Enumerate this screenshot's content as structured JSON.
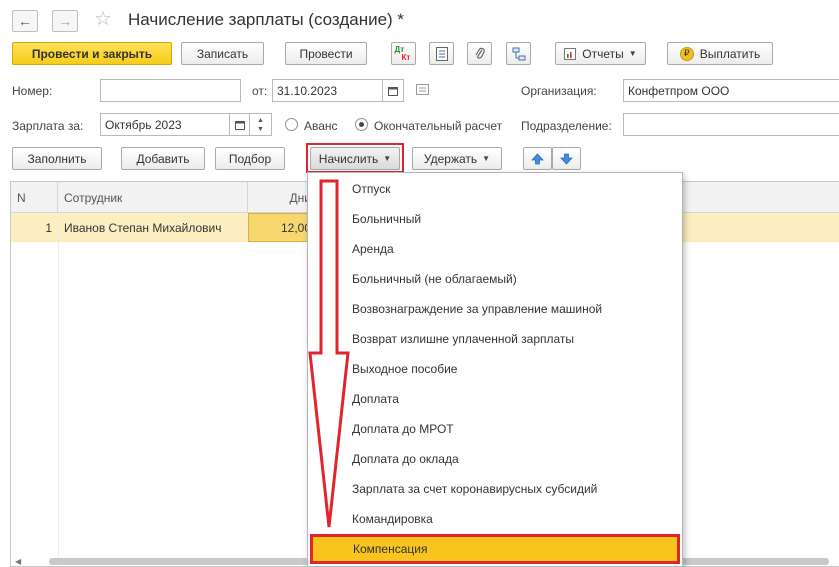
{
  "window": {
    "back_icon": "arrow-left-icon",
    "forward_icon": "arrow-right-icon",
    "favorite_icon": "star-icon",
    "title": "Начисление зарплаты (создание) *"
  },
  "toolbar": {
    "post_close": "Провести и закрыть",
    "save": "Записать",
    "post": "Провести",
    "dt_label": "Дт",
    "kt_label": "Кт",
    "reports": "Отчеты",
    "pay": "Выплатить",
    "pay_coin": "₽"
  },
  "form": {
    "number_label": "Номер:",
    "number_value": "",
    "date_label": "от:",
    "date_value": "31.10.2023",
    "org_label": "Организация:",
    "org_value": "Конфетпром ООО",
    "salary_label": "Зарплата за:",
    "salary_value": "Октябрь 2023",
    "advance_label": "Аванс",
    "final_label": "Окончательный расчет",
    "calc_mode": "final",
    "division_label": "Подразделение:",
    "division_value": ""
  },
  "table_toolbar": {
    "fill": "Заполнить",
    "add": "Добавить",
    "select": "Подбор",
    "accrue": "Начислить",
    "withhold": "Удержать"
  },
  "table": {
    "columns": [
      "N",
      "Сотрудник",
      "Дни"
    ],
    "rows": [
      {
        "n": "1",
        "employee": "Иванов Степан Михайлович",
        "days": "12,00"
      }
    ]
  },
  "accrue_menu": {
    "items": [
      "Отпуск",
      "Больничный",
      "Аренда",
      "Больничный (не облагаемый)",
      "Возвознаграждение за управление машиной",
      "Возврат излишне уплаченной зарплаты",
      "Выходное пособие",
      "Доплата",
      "Доплата до МРОТ",
      "Доплата до оклада",
      "Зарплата за счет коронавирусных субсидий",
      "Командировка",
      "Компенсация"
    ],
    "highlighted": "Компенсация"
  },
  "colors": {
    "accent_yellow": "#f7c51c",
    "highlight_red": "#e0262c",
    "row_selected": "#fbeec0"
  }
}
